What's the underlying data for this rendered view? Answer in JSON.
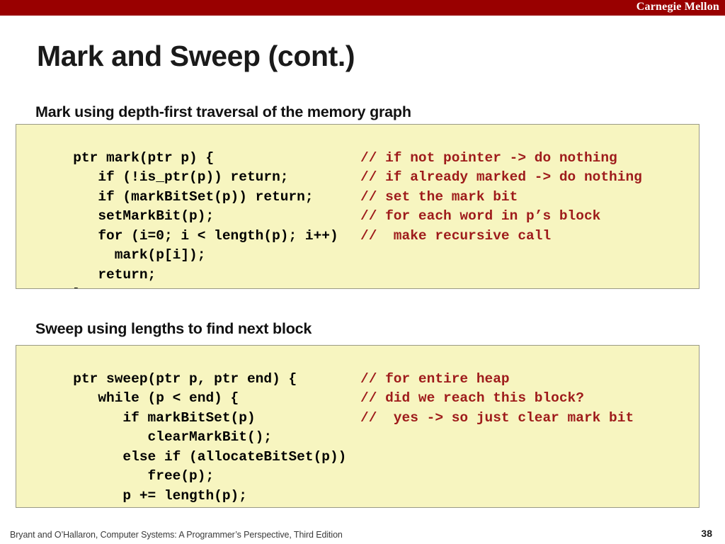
{
  "banner": {
    "brand": "Carnegie Mellon",
    "color": "#990000"
  },
  "slide": {
    "title": "Mark and Sweep (cont.)",
    "page_number": "38"
  },
  "sections": [
    {
      "heading": "Mark using depth-first traversal of the memory graph",
      "code_background": "#F7F5C0",
      "comment_color": "#9E1B1B",
      "lines": [
        {
          "code": "ptr mark(ptr p) {",
          "comment": ""
        },
        {
          "code": "   if (!is_ptr(p)) return;",
          "comment": "// if not pointer -> do nothing"
        },
        {
          "code": "   if (markBitSet(p)) return;",
          "comment": "// if already marked -> do nothing"
        },
        {
          "code": "   setMarkBit(p);",
          "comment": "// set the mark bit"
        },
        {
          "code": "   for (i=0; i < length(p); i++)",
          "comment": "// for each word in p’s block"
        },
        {
          "code": "     mark(p[i]);",
          "comment": "//  make recursive call"
        },
        {
          "code": "   return;",
          "comment": ""
        },
        {
          "code": "}",
          "comment": ""
        }
      ]
    },
    {
      "heading": "Sweep using lengths to find next block",
      "code_background": "#F7F5C0",
      "comment_color": "#9E1B1B",
      "lines": [
        {
          "code": "ptr sweep(ptr p, ptr end) {",
          "comment": ""
        },
        {
          "code": "   while (p < end) {",
          "comment": "// for entire heap"
        },
        {
          "code": "      if markBitSet(p)",
          "comment": "// did we reach this block?"
        },
        {
          "code": "         clearMarkBit();",
          "comment": "//  yes -> so just clear mark bit"
        },
        {
          "code": "      else if (allocateBitSet(p))",
          "comment": ""
        },
        {
          "code": "         free(p);",
          "comment": ""
        },
        {
          "code": "      p += length(p);",
          "comment": ""
        },
        {
          "code": "}",
          "comment": ""
        }
      ]
    }
  ],
  "footer": {
    "attribution": "Bryant and O’Hallaron, Computer Systems: A Programmer’s Perspective, Third Edition"
  }
}
